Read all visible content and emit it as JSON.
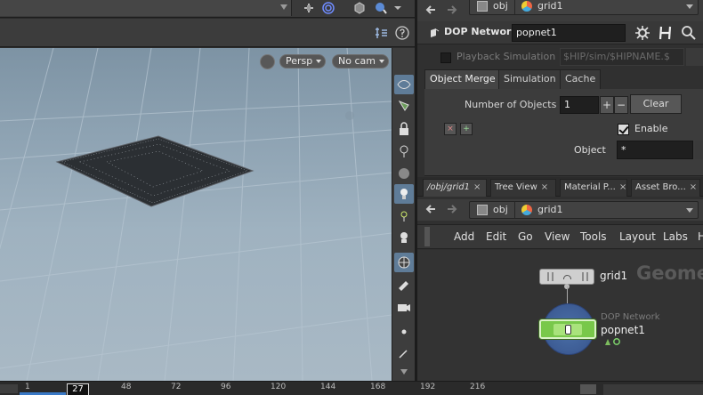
{
  "viewport": {
    "camera_mode": "Persp",
    "camera_select": "No cam"
  },
  "params": {
    "path": {
      "root": "obj",
      "node": "grid1"
    },
    "node_type": "DOP Network",
    "node_name": "popnet1",
    "playback_label": "Playback Simulation",
    "playback_path": "$HIP/sim/$HIPNAME.$",
    "tabs": [
      "Object Merge",
      "Simulation",
      "Cache"
    ],
    "num_objects_label": "Number of Objects",
    "num_objects": "1",
    "plus": "+",
    "minus": "−",
    "clear": "Clear",
    "enable_label": "Enable",
    "object_label": "Object",
    "object_value": "*",
    "icon_x": "×",
    "icon_plus": "+"
  },
  "pane_tabs": [
    {
      "label": "/obj/grid1",
      "close": "×"
    },
    {
      "label": "Tree View",
      "close": "×"
    },
    {
      "label": "Material P...",
      "close": "×"
    },
    {
      "label": "Asset Bro...",
      "close": "×"
    }
  ],
  "network": {
    "path": {
      "root": "obj",
      "node": "grid1"
    },
    "menu": [
      "Add",
      "Edit",
      "Go",
      "View",
      "Tools",
      "Layout",
      "Labs",
      "H"
    ],
    "context_title": "Geometry",
    "grid_node": "grid1",
    "dop_type": "DOP Network",
    "dop_name": "popnet1"
  },
  "timeline": {
    "ticks": [
      "1",
      "48",
      "72",
      "96",
      "120",
      "144",
      "168",
      "192",
      "216"
    ],
    "current_frame": "27"
  },
  "colors": {
    "selection_blue": "#5f7c98",
    "dop_node_green": "#78c84a",
    "dop_circle_blue": "#4a6fa8",
    "timeline_range": "#3a79c6"
  }
}
